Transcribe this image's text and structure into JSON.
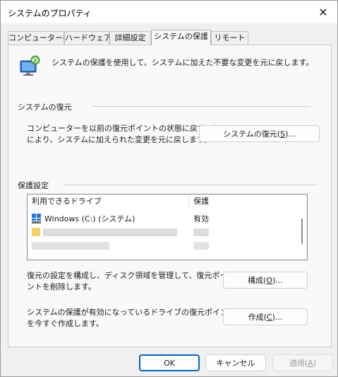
{
  "window": {
    "title": "システムのプロパティ"
  },
  "tabs": [
    {
      "label": "コンピューター名",
      "active": false
    },
    {
      "label": "ハードウェア",
      "active": false
    },
    {
      "label": "詳細設定",
      "active": false
    },
    {
      "label": "システムの保護",
      "active": true
    },
    {
      "label": "リモート",
      "active": false
    }
  ],
  "intro": {
    "text": "システムの保護を使用して、システムに加えた不要な変更を元に戻します。"
  },
  "restore": {
    "group_title": "システムの復元",
    "desc_line1": "コンピューターを以前の復元ポイントの状態に戻すこと",
    "desc_line2": "により、システムに加えられた変更を元に戻します。",
    "button_prefix": "システムの復元(",
    "button_key": "S",
    "button_suffix": ")..."
  },
  "protection": {
    "group_title": "保護設定",
    "columns": [
      "利用できるドライブ",
      "保護"
    ],
    "rows": [
      {
        "drive": "Windows (C:) (システム)",
        "status": "有効"
      }
    ],
    "configure_desc_line1": "復元の設定を構成し、ディスク領域を管理して、復元ポイ",
    "configure_desc_line2": "ントを削除します。",
    "configure_prefix": "構成(",
    "configure_key": "O",
    "configure_suffix": ")...",
    "create_desc_line1": "システムの保護が有効になっているドライブの復元ポイント",
    "create_desc_line2": "を今すぐ作成します。",
    "create_prefix": "作成(",
    "create_key": "C",
    "create_suffix": ")..."
  },
  "footer": {
    "ok": "OK",
    "cancel": "キャンセル",
    "apply_prefix": "適用(",
    "apply_key": "A",
    "apply_suffix": ")"
  },
  "colors": {
    "accent": "#0067c0",
    "panel_bg": "#f9f9f9",
    "window_bg": "#f0f0f0"
  }
}
